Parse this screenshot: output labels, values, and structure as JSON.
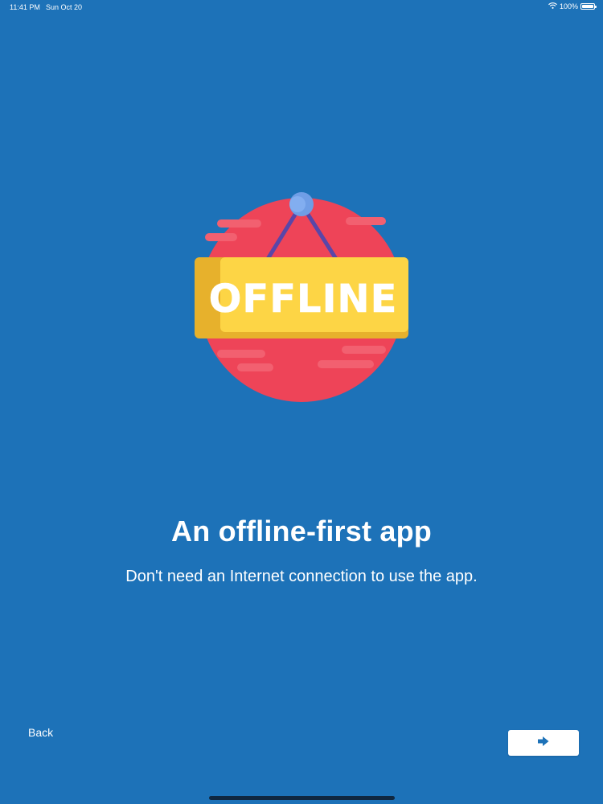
{
  "status_bar": {
    "time": "11:41 PM",
    "date": "Sun Oct 20",
    "battery_percent": "100%",
    "battery_level": 1.0
  },
  "illustration": {
    "sign_text": "OFFLINE",
    "colors": {
      "circle": "#ee4458",
      "sign_front": "#fdd545",
      "sign_side": "#e7b12c",
      "hook": "#6f9ee6",
      "strings": "#5a46a8"
    }
  },
  "onboarding": {
    "title": "An offline-first app",
    "description": "Don't need an Internet connection to use the app."
  },
  "navigation": {
    "back_label": "Back",
    "next_icon": "arrow-right-icon"
  },
  "colors": {
    "background": "#1d72b8",
    "accent": "#1d72b8",
    "text": "#ffffff"
  }
}
